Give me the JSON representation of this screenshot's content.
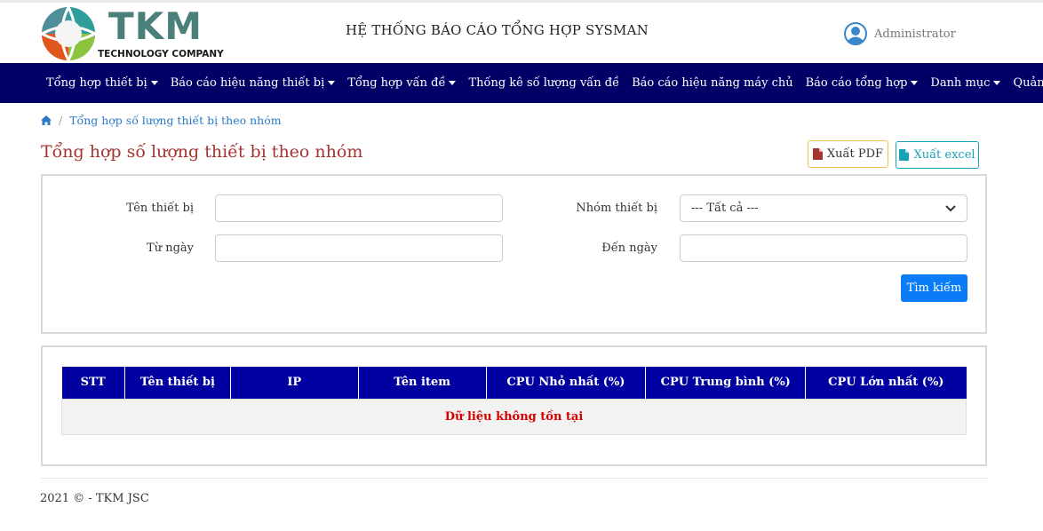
{
  "header": {
    "logo_big": "TKM",
    "logo_small": "TECHNOLOGY COMPANY",
    "system_title": "HỆ THỐNG BÁO CÁO TỔNG HỢP SYSMAN",
    "user_name": "Administrator"
  },
  "nav": {
    "items": [
      {
        "label": "Tổng hợp thiết bị",
        "dropdown": true
      },
      {
        "label": "Báo cáo hiệu năng thiết bị",
        "dropdown": true
      },
      {
        "label": "Tổng hợp vấn đề",
        "dropdown": true
      },
      {
        "label": "Thống kê số lượng vấn đề",
        "dropdown": false
      },
      {
        "label": "Báo cáo hiệu năng máy chủ",
        "dropdown": false
      },
      {
        "label": "Báo cáo tổng hợp",
        "dropdown": true
      },
      {
        "label": "Danh mục",
        "dropdown": true
      },
      {
        "label": "Quản trị",
        "dropdown": true
      }
    ]
  },
  "breadcrumb": {
    "separator": "/",
    "current": "Tổng hợp số lượng thiết bị theo nhóm"
  },
  "page": {
    "title": "Tổng hợp số lượng thiết bị theo nhóm",
    "export_pdf": "Xuất PDF",
    "export_excel": "Xuất excel"
  },
  "filter": {
    "device_name_label": "Tên thiết bị",
    "device_name_value": "",
    "device_group_label": "Nhóm thiết bị",
    "device_group_selected": "--- Tất cả ---",
    "from_date_label": "Từ ngày",
    "from_date_value": "",
    "to_date_label": "Đến ngày",
    "to_date_value": "",
    "search_button": "Tìm kiếm"
  },
  "table": {
    "columns": [
      "STT",
      "Tên thiết bị",
      "IP",
      "Tên item",
      "CPU Nhỏ nhất (%)",
      "CPU Trung bình (%)",
      "CPU Lớn nhất (%)"
    ],
    "empty_message": "Dữ liệu không tồn tại"
  },
  "footer": {
    "text": "2021 © - TKM JSC"
  },
  "colors": {
    "nav_bg": "#010066",
    "table_header_bg": "#0000a0",
    "title_color": "#a3342f",
    "primary_button": "#0a7cf5",
    "excel_button": "#17a2b8",
    "pdf_button_border": "#f2c14e",
    "empty_message": "#d40000"
  }
}
